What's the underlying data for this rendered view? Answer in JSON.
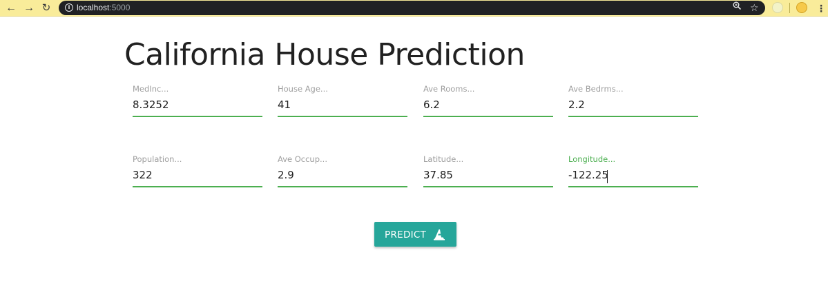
{
  "browser": {
    "url_host": "localhost",
    "url_port": ":5000",
    "back_icon": "arrow-left",
    "forward_icon": "arrow-right",
    "reload_icon": "reload",
    "info_icon": "info",
    "zoom_icon": "magnifier",
    "bookmark_icon": "star",
    "menu_icon": "vertical-dots"
  },
  "page": {
    "title": "California House Prediction"
  },
  "form": {
    "fields": [
      {
        "label": "MedInc...",
        "value": "8.3252"
      },
      {
        "label": "House Age...",
        "value": "41"
      },
      {
        "label": "Ave Rooms...",
        "value": "6.2"
      },
      {
        "label": "Ave Bedrms...",
        "value": "2.2"
      },
      {
        "label": "Population...",
        "value": "322"
      },
      {
        "label": "Ave Occup...",
        "value": "2.9"
      },
      {
        "label": "Latitude...",
        "value": "37.85"
      },
      {
        "label": "Longitude...",
        "value": "-122.25"
      }
    ],
    "active_field": "Longitude...",
    "accent_color": "#4caf50"
  },
  "predict_button": {
    "label": "PREDICT",
    "icon": "wizard-hat-icon",
    "color": "#26a69a"
  }
}
